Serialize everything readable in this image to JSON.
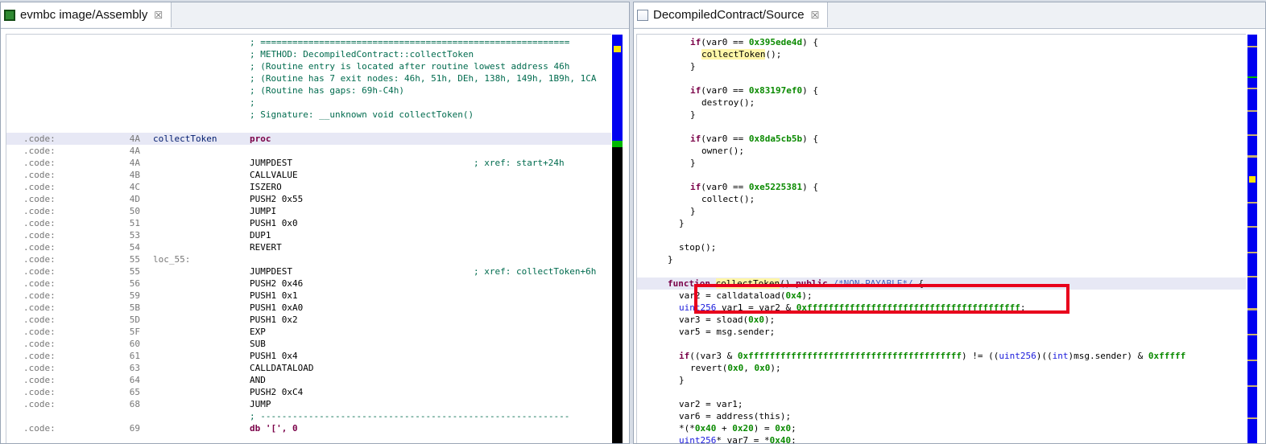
{
  "left_pane": {
    "tab_title": "evmbc image/Assembly",
    "header_comments": [
      "; ==========================================================",
      "; METHOD: DecompiledContract::collectToken",
      "; (Routine entry is located after routine lowest address 46h",
      "; (Routine has 7 exit nodes: 46h, 51h, DEh, 138h, 149h, 1B9h, 1CA",
      "; (Routine has gaps: 69h-C4h)",
      ";",
      "; Signature: __unknown void collectToken()"
    ],
    "rows": [
      {
        "seg": ".code:",
        "addr": "4A",
        "label": "collectToken",
        "instr": "proc",
        "xref": ""
      },
      {
        "seg": ".code:",
        "addr": "4A",
        "label": "",
        "instr": "",
        "xref": ""
      },
      {
        "seg": ".code:",
        "addr": "4A",
        "label": "",
        "instr": "JUMPDEST",
        "xref": "; xref: start+24h"
      },
      {
        "seg": ".code:",
        "addr": "4B",
        "label": "",
        "instr": "CALLVALUE",
        "xref": ""
      },
      {
        "seg": ".code:",
        "addr": "4C",
        "label": "",
        "instr": "ISZERO",
        "xref": ""
      },
      {
        "seg": ".code:",
        "addr": "4D",
        "label": "",
        "instr": "PUSH2 0x55",
        "xref": ""
      },
      {
        "seg": ".code:",
        "addr": "50",
        "label": "",
        "instr": "JUMPI",
        "xref": ""
      },
      {
        "seg": ".code:",
        "addr": "51",
        "label": "",
        "instr": "PUSH1 0x0",
        "xref": ""
      },
      {
        "seg": ".code:",
        "addr": "53",
        "label": "",
        "instr": "DUP1",
        "xref": ""
      },
      {
        "seg": ".code:",
        "addr": "54",
        "label": "",
        "instr": "REVERT",
        "xref": ""
      },
      {
        "seg": ".code:",
        "addr": "55",
        "label": "loc_55:",
        "instr": "",
        "xref": ""
      },
      {
        "seg": ".code:",
        "addr": "55",
        "label": "",
        "instr": "JUMPDEST",
        "xref": "; xref: collectToken+6h"
      },
      {
        "seg": ".code:",
        "addr": "56",
        "label": "",
        "instr": "PUSH2 0x46",
        "xref": ""
      },
      {
        "seg": ".code:",
        "addr": "59",
        "label": "",
        "instr": "PUSH1 0x1",
        "xref": ""
      },
      {
        "seg": ".code:",
        "addr": "5B",
        "label": "",
        "instr": "PUSH1 0xA0",
        "xref": ""
      },
      {
        "seg": ".code:",
        "addr": "5D",
        "label": "",
        "instr": "PUSH1 0x2",
        "xref": ""
      },
      {
        "seg": ".code:",
        "addr": "5F",
        "label": "",
        "instr": "EXP",
        "xref": ""
      },
      {
        "seg": ".code:",
        "addr": "60",
        "label": "",
        "instr": "SUB",
        "xref": ""
      },
      {
        "seg": ".code:",
        "addr": "61",
        "label": "",
        "instr": "PUSH1 0x4",
        "xref": ""
      },
      {
        "seg": ".code:",
        "addr": "63",
        "label": "",
        "instr": "CALLDATALOAD",
        "xref": ""
      },
      {
        "seg": ".code:",
        "addr": "64",
        "label": "",
        "instr": "AND",
        "xref": ""
      },
      {
        "seg": ".code:",
        "addr": "65",
        "label": "",
        "instr": "PUSH2 0xC4",
        "xref": ""
      },
      {
        "seg": ".code:",
        "addr": "68",
        "label": "",
        "instr": "JUMP",
        "xref": ""
      }
    ],
    "separator": "; ----------------------------------------------------------",
    "last_row": {
      "seg": ".code:",
      "addr": "69",
      "instr": "db '[', 0"
    }
  },
  "right_pane": {
    "tab_title": "DecompiledContract/Source",
    "lines": [
      {
        "indent": 6,
        "tokens": [
          [
            "kw",
            "if"
          ],
          [
            "",
            "(var0 == "
          ],
          [
            "num",
            "0x395ede4d"
          ],
          [
            "",
            ") {"
          ]
        ]
      },
      {
        "indent": 8,
        "tokens": [
          [
            "fnhl",
            "collectToken"
          ],
          [
            "",
            "();"
          ]
        ]
      },
      {
        "indent": 6,
        "tokens": [
          [
            "",
            "}"
          ]
        ]
      },
      {
        "indent": 0,
        "tokens": []
      },
      {
        "indent": 6,
        "tokens": [
          [
            "kw",
            "if"
          ],
          [
            "",
            "(var0 == "
          ],
          [
            "num",
            "0x83197ef0"
          ],
          [
            "",
            ") {"
          ]
        ]
      },
      {
        "indent": 8,
        "tokens": [
          [
            "",
            "destroy();"
          ]
        ]
      },
      {
        "indent": 6,
        "tokens": [
          [
            "",
            "}"
          ]
        ]
      },
      {
        "indent": 0,
        "tokens": []
      },
      {
        "indent": 6,
        "tokens": [
          [
            "kw",
            "if"
          ],
          [
            "",
            "(var0 == "
          ],
          [
            "num",
            "0x8da5cb5b"
          ],
          [
            "",
            ") {"
          ]
        ]
      },
      {
        "indent": 8,
        "tokens": [
          [
            "",
            "owner();"
          ]
        ]
      },
      {
        "indent": 6,
        "tokens": [
          [
            "",
            "}"
          ]
        ]
      },
      {
        "indent": 0,
        "tokens": []
      },
      {
        "indent": 6,
        "tokens": [
          [
            "kw",
            "if"
          ],
          [
            "",
            "(var0 == "
          ],
          [
            "num",
            "0xe5225381"
          ],
          [
            "",
            ") {"
          ]
        ]
      },
      {
        "indent": 8,
        "tokens": [
          [
            "",
            "collect();"
          ]
        ]
      },
      {
        "indent": 6,
        "tokens": [
          [
            "",
            "}"
          ]
        ]
      },
      {
        "indent": 4,
        "tokens": [
          [
            "",
            "}"
          ]
        ]
      },
      {
        "indent": 0,
        "tokens": []
      },
      {
        "indent": 4,
        "tokens": [
          [
            "",
            "stop();"
          ]
        ]
      },
      {
        "indent": 2,
        "tokens": [
          [
            "",
            "}"
          ]
        ]
      },
      {
        "indent": 0,
        "tokens": []
      },
      {
        "indent": 2,
        "hl": true,
        "tokens": [
          [
            "kw",
            "function "
          ],
          [
            "fnhl",
            "collectToken"
          ],
          [
            "",
            "() "
          ],
          [
            "kw",
            "public "
          ],
          [
            "cmt",
            "/*NON-PAYABLE*/"
          ],
          [
            "",
            " {"
          ]
        ]
      },
      {
        "indent": 4,
        "tokens": [
          [
            "",
            "var2 = calldataload("
          ],
          [
            "num",
            "0x4"
          ],
          [
            "",
            ");"
          ]
        ]
      },
      {
        "indent": 4,
        "tokens": [
          [
            "typ",
            "uint256"
          ],
          [
            "",
            " var1 = var2 & "
          ],
          [
            "num",
            "0xffffffffffffffffffffffffffffffffffffffff"
          ],
          [
            "",
            ";"
          ]
        ]
      },
      {
        "indent": 4,
        "tokens": [
          [
            "",
            "var3 = sload("
          ],
          [
            "num",
            "0x0"
          ],
          [
            "",
            ");"
          ]
        ]
      },
      {
        "indent": 4,
        "tokens": [
          [
            "",
            "var5 = msg.sender;"
          ]
        ]
      },
      {
        "indent": 0,
        "tokens": []
      },
      {
        "indent": 4,
        "tokens": [
          [
            "kw",
            "if"
          ],
          [
            "",
            "((var3 & "
          ],
          [
            "num",
            "0xffffffffffffffffffffffffffffffffffffffff"
          ],
          [
            "",
            ") != (("
          ],
          [
            "typ",
            "uint256"
          ],
          [
            "",
            ")(("
          ],
          [
            "typ",
            "int"
          ],
          [
            "",
            ")msg.sender) & "
          ],
          [
            "num",
            "0xfffff"
          ]
        ]
      },
      {
        "indent": 6,
        "tokens": [
          [
            "",
            "revert("
          ],
          [
            "num",
            "0x0"
          ],
          [
            "",
            ", "
          ],
          [
            "num",
            "0x0"
          ],
          [
            "",
            ");"
          ]
        ]
      },
      {
        "indent": 4,
        "tokens": [
          [
            "",
            "}"
          ]
        ]
      },
      {
        "indent": 0,
        "tokens": []
      },
      {
        "indent": 4,
        "tokens": [
          [
            "",
            "var2 = var1;"
          ]
        ]
      },
      {
        "indent": 4,
        "tokens": [
          [
            "",
            "var6 = address(this);"
          ]
        ]
      },
      {
        "indent": 4,
        "tokens": [
          [
            "",
            "*(*"
          ],
          [
            "num",
            "0x40"
          ],
          [
            "",
            " + "
          ],
          [
            "num",
            "0x20"
          ],
          [
            "",
            ") = "
          ],
          [
            "num",
            "0x0"
          ],
          [
            "",
            ";"
          ]
        ]
      },
      {
        "indent": 4,
        "tokens": [
          [
            "typ",
            "uint256"
          ],
          [
            "",
            "* var7 = *"
          ],
          [
            "num",
            "0x40"
          ],
          [
            "",
            ";"
          ]
        ]
      }
    ]
  },
  "colors": {
    "scroll_blue": "#0000f0",
    "highlight": "#e7e8f5",
    "red_box": "#e8001c"
  }
}
